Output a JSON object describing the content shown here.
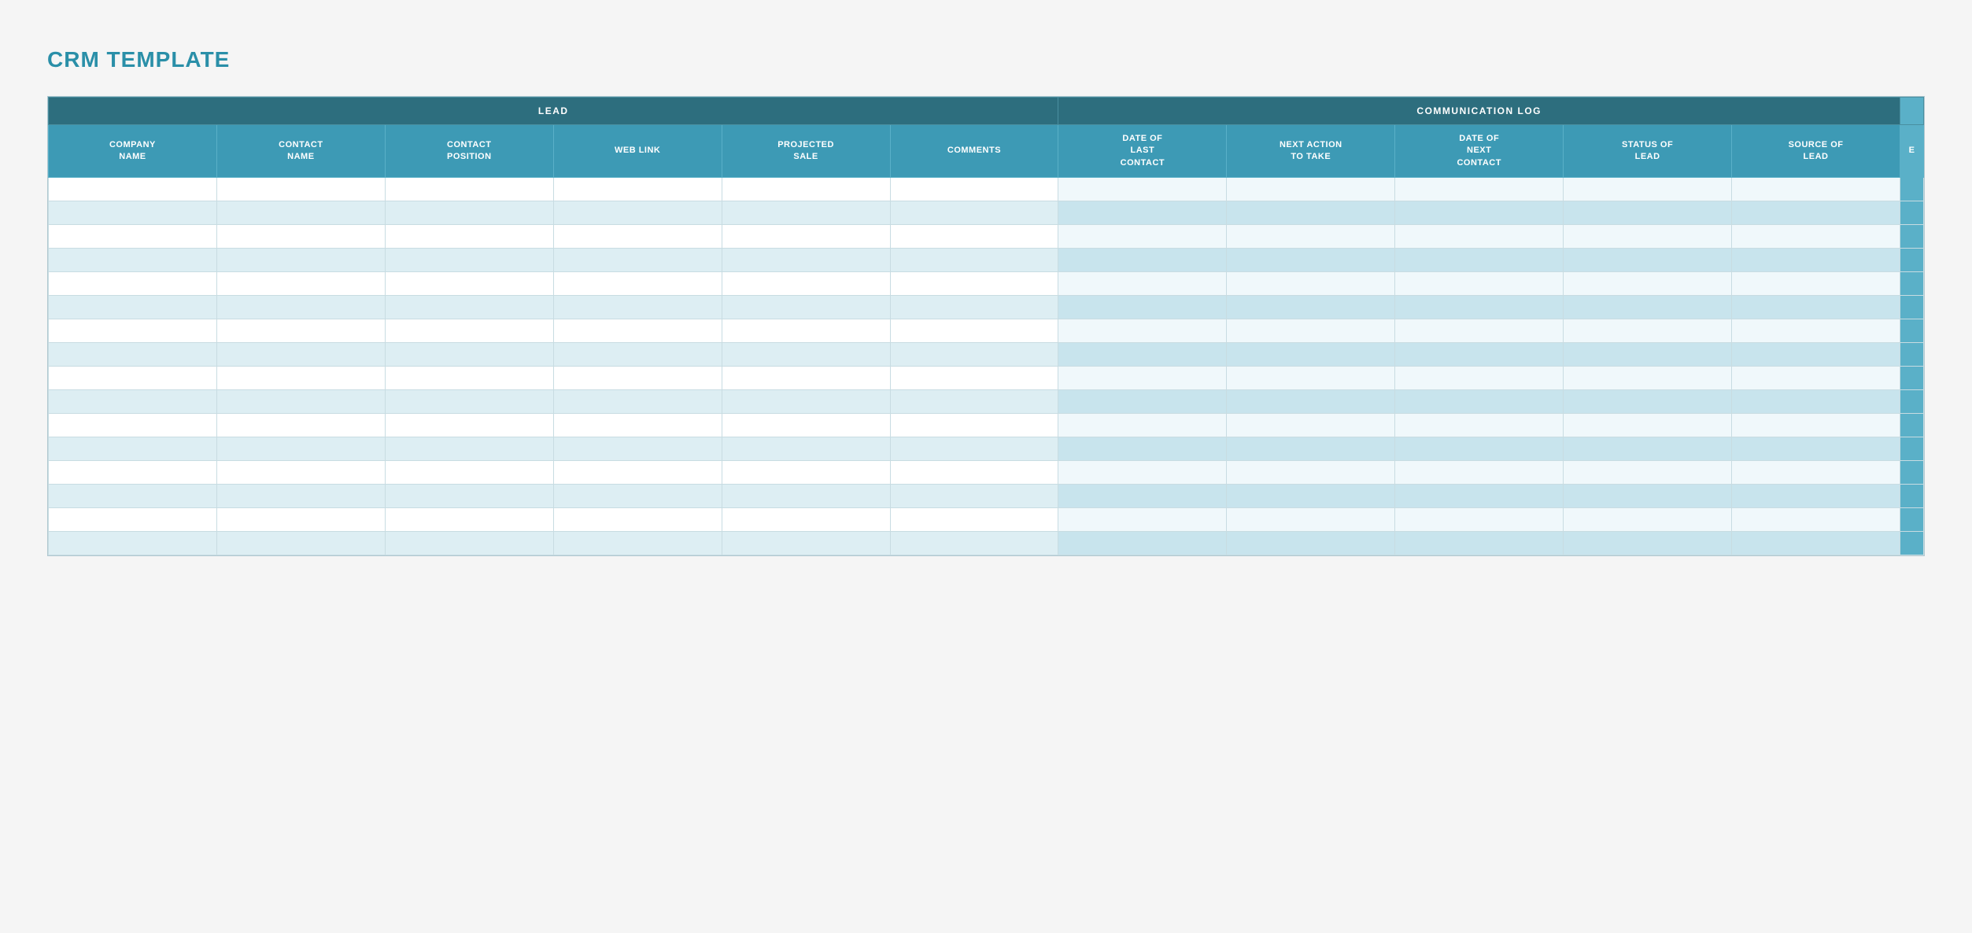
{
  "title": "CRM TEMPLATE",
  "table": {
    "section_headers": [
      {
        "label": "LEAD",
        "colspan": 6
      },
      {
        "label": "COMMUNICATION LOG",
        "colspan": 6
      }
    ],
    "column_headers": [
      {
        "id": "company_name",
        "label": "COMPANY NAME",
        "section": "lead"
      },
      {
        "id": "contact_name",
        "label": "CONTACT NAME",
        "section": "lead"
      },
      {
        "id": "contact_position",
        "label": "CONTACT POSITION",
        "section": "lead"
      },
      {
        "id": "web_link",
        "label": "WEB LINK",
        "section": "lead"
      },
      {
        "id": "projected_sale",
        "label": "PROJECTED SALE",
        "section": "lead"
      },
      {
        "id": "comments",
        "label": "COMMENTS",
        "section": "lead"
      },
      {
        "id": "date_last_contact",
        "label": "DATE OF LAST CONTACT",
        "section": "comm"
      },
      {
        "id": "next_action",
        "label": "NEXT ACTION TO TAKE",
        "section": "comm"
      },
      {
        "id": "date_next_contact",
        "label": "DATE OF NEXT CONTACT",
        "section": "comm"
      },
      {
        "id": "status_lead",
        "label": "STATUS OF LEAD",
        "section": "comm"
      },
      {
        "id": "source_lead",
        "label": "SOURCE OF LEAD",
        "section": "comm"
      },
      {
        "id": "extra",
        "label": "E",
        "section": "comm"
      }
    ],
    "row_count": 16
  }
}
